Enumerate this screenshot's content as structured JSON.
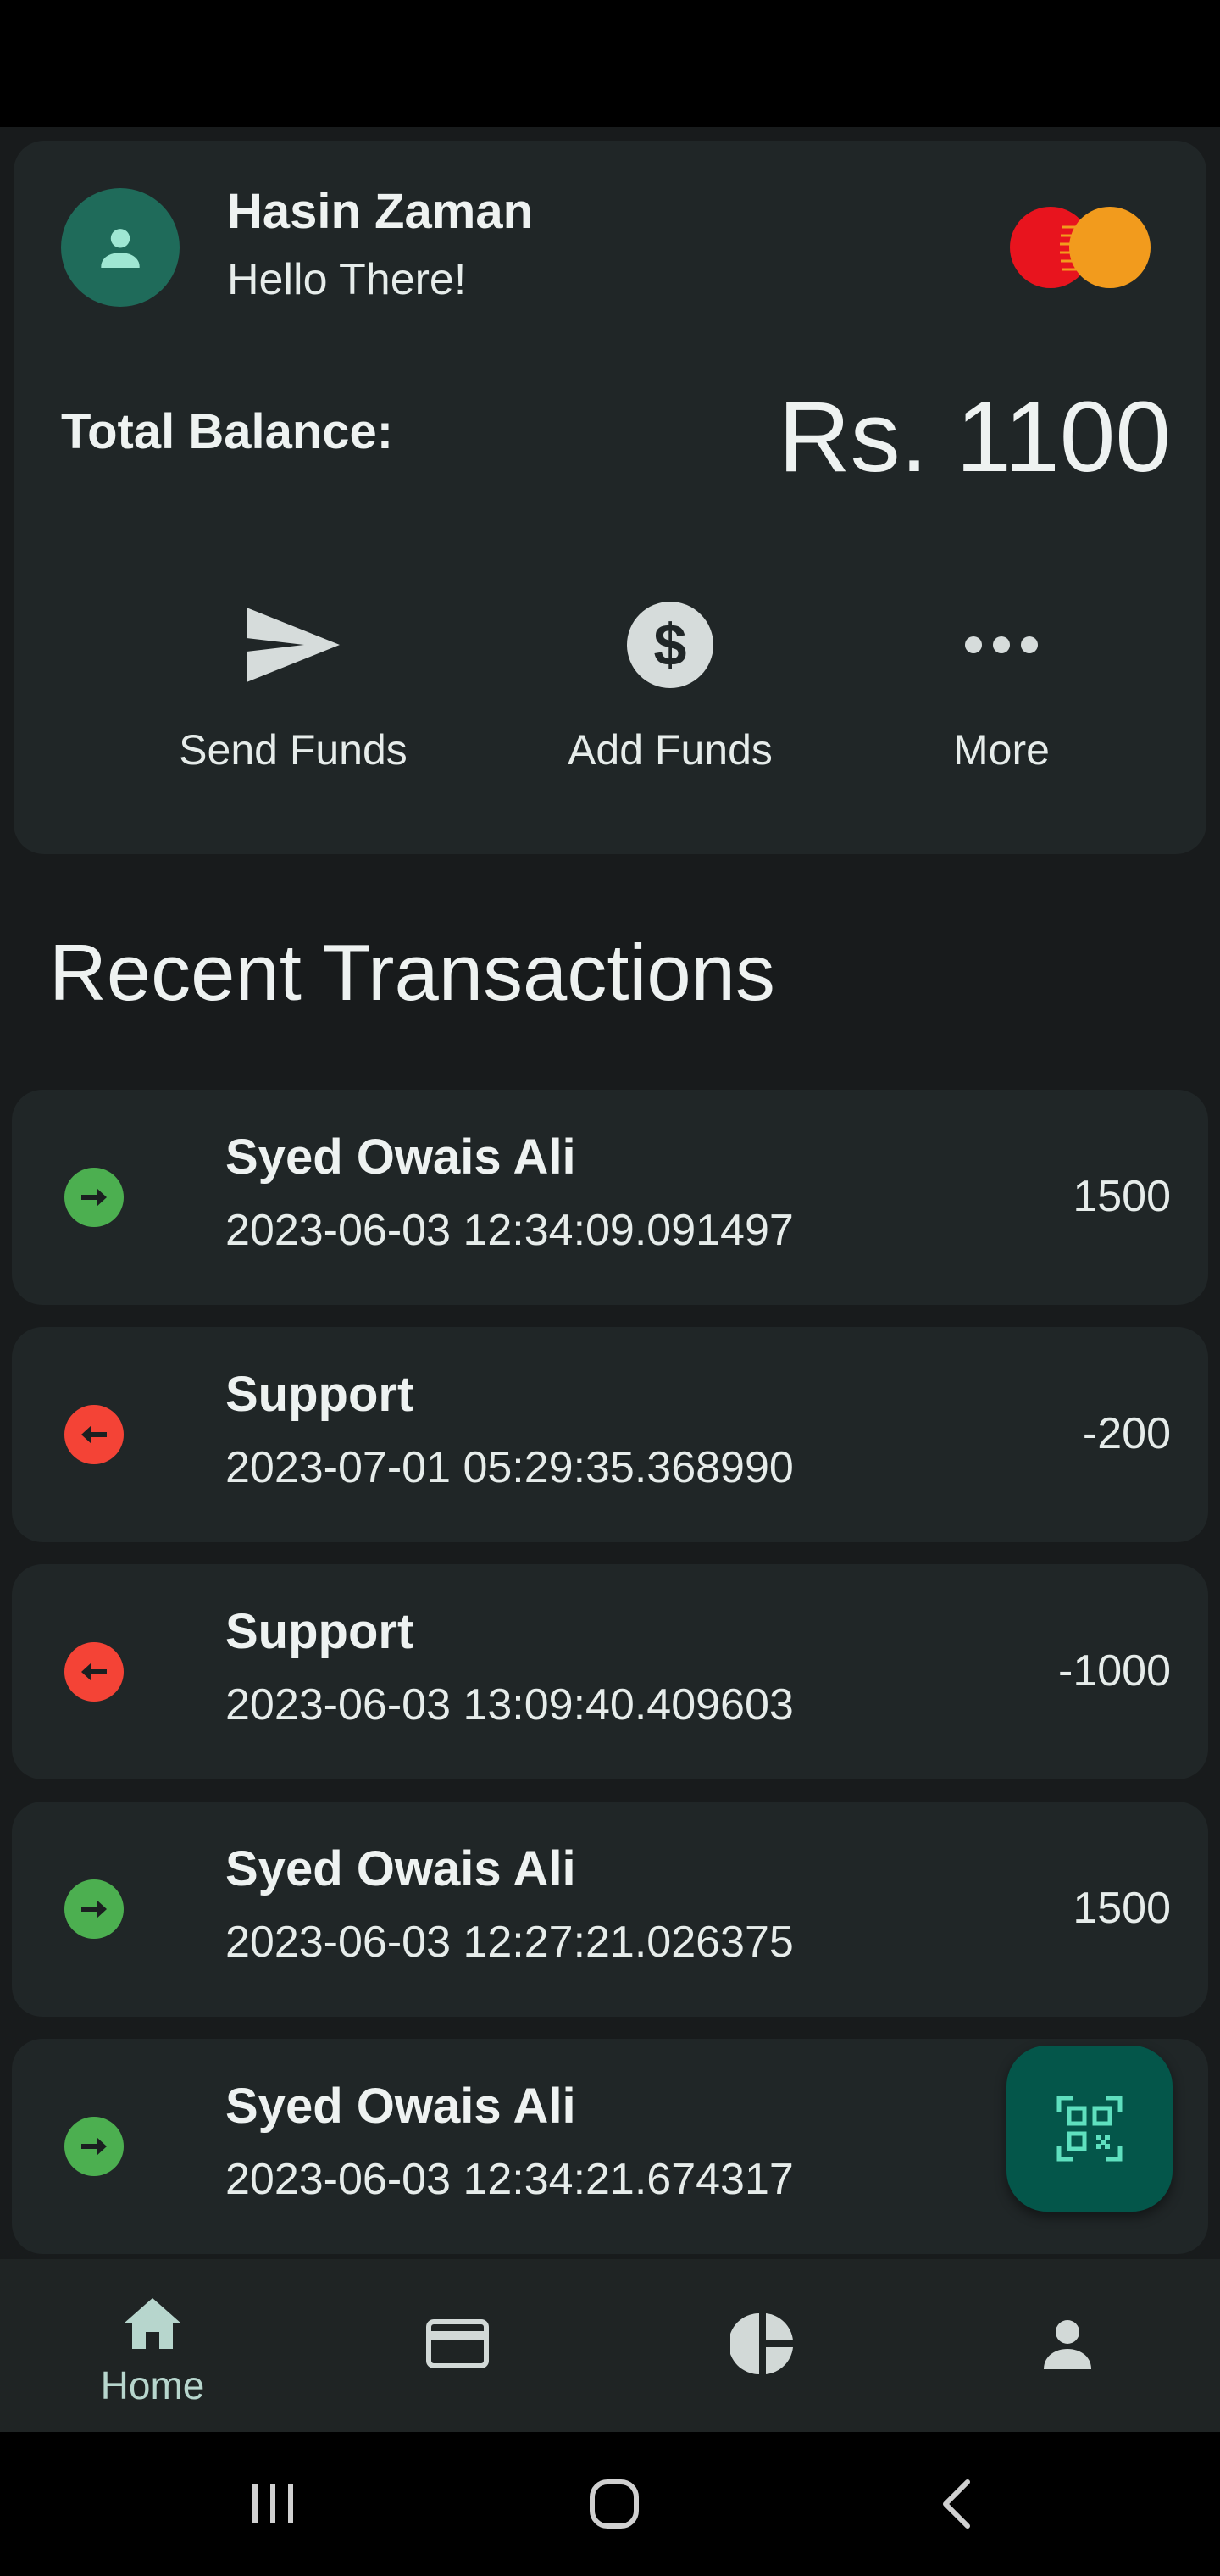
{
  "user": {
    "name": "Hasin Zaman",
    "greeting": "Hello There!",
    "card_brand_icon": "mastercard-logo"
  },
  "balance": {
    "label": "Total Balance:",
    "value": "Rs. 1100"
  },
  "actions": [
    {
      "label": "Send Funds",
      "icon": "send-icon"
    },
    {
      "label": "Add Funds",
      "icon": "dollar-circle-icon"
    },
    {
      "label": "More",
      "icon": "more-horizontal-icon"
    }
  ],
  "transactions_title": "Recent Transactions",
  "transactions": [
    {
      "name": "Syed Owais Ali",
      "date": "2023-06-03 12:34:09.091497",
      "amount": "1500",
      "direction": "incoming"
    },
    {
      "name": "Support",
      "date": "2023-07-01 05:29:35.368990",
      "amount": "-200",
      "direction": "outgoing"
    },
    {
      "name": "Support",
      "date": "2023-06-03 13:09:40.409603",
      "amount": "-1000",
      "direction": "outgoing"
    },
    {
      "name": "Syed Owais Ali",
      "date": "2023-06-03 12:27:21.026375",
      "amount": "1500",
      "direction": "incoming"
    },
    {
      "name": "Syed Owais Ali",
      "date": "2023-06-03 12:34:21.674317",
      "amount": "",
      "direction": "incoming"
    }
  ],
  "fab": {
    "icon": "qr-scan-icon"
  },
  "bottom_nav": {
    "items": [
      {
        "label": "Home",
        "icon": "home-icon",
        "active": true
      },
      {
        "label": "",
        "icon": "credit-card-icon",
        "active": false
      },
      {
        "label": "",
        "icon": "pie-chart-icon",
        "active": false
      },
      {
        "label": "",
        "icon": "person-icon",
        "active": false
      }
    ]
  },
  "colors": {
    "background": "#181b1c",
    "card": "#202627",
    "accent": "#1f6b5a",
    "fab": "#04564a",
    "incoming": "#4caf50",
    "outgoing": "#f44336",
    "nav_active": "#b7d6cd"
  }
}
